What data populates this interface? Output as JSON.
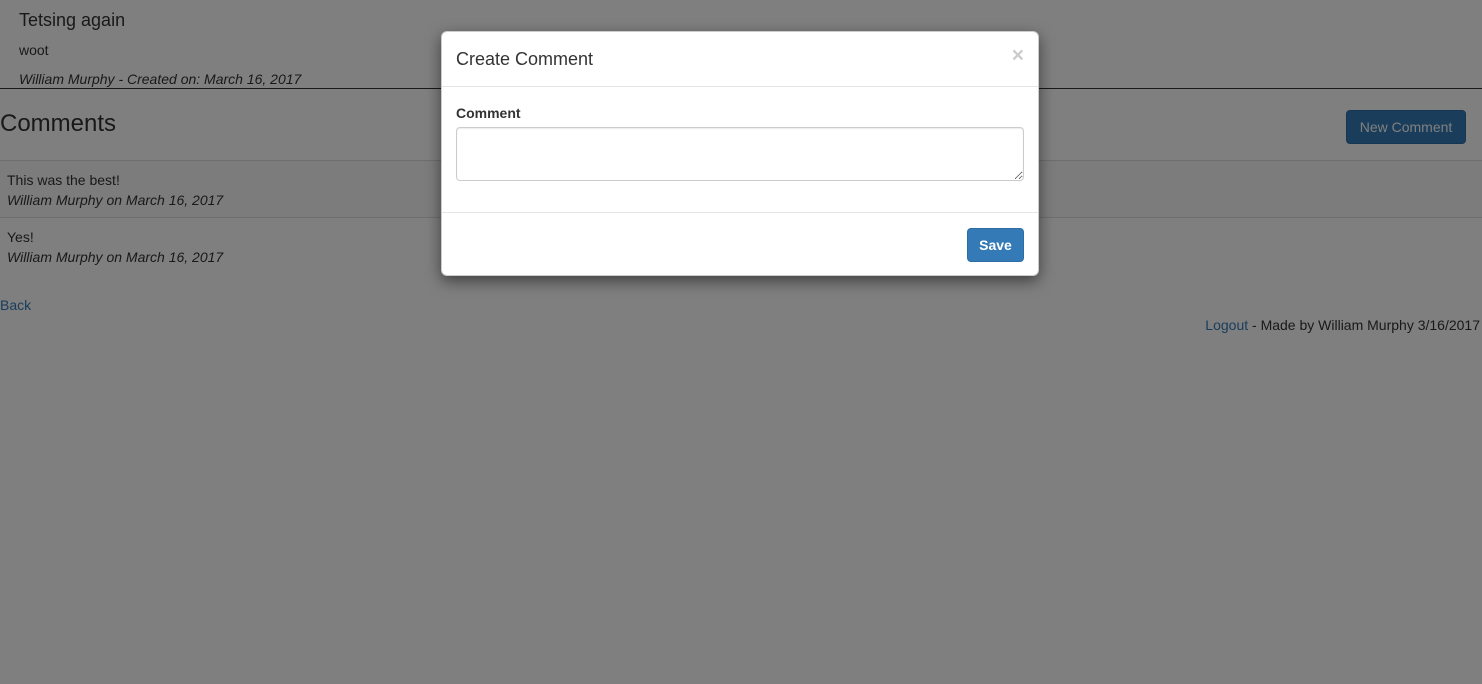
{
  "post": {
    "title": "Tetsing again",
    "body": "woot",
    "meta": "William Murphy - Created on: March 16, 2017"
  },
  "comments": {
    "heading": "Comments",
    "new_button_label": "New Comment",
    "items": [
      {
        "text": "This was the best!",
        "meta": "William Murphy on March 16, 2017"
      },
      {
        "text": "Yes!",
        "meta": "William Murphy on March 16, 2017"
      }
    ]
  },
  "nav": {
    "back_label": "Back"
  },
  "footer": {
    "logout_label": "Logout",
    "credit": " - Made by William Murphy 3/16/2017"
  },
  "modal": {
    "title": "Create Comment",
    "close_glyph": "×",
    "field_label": "Comment",
    "textarea_value": "",
    "textarea_placeholder": "",
    "save_label": "Save"
  },
  "colors": {
    "primary": "#337ab7",
    "backdrop": "rgba(0,0,0,0.5)"
  }
}
